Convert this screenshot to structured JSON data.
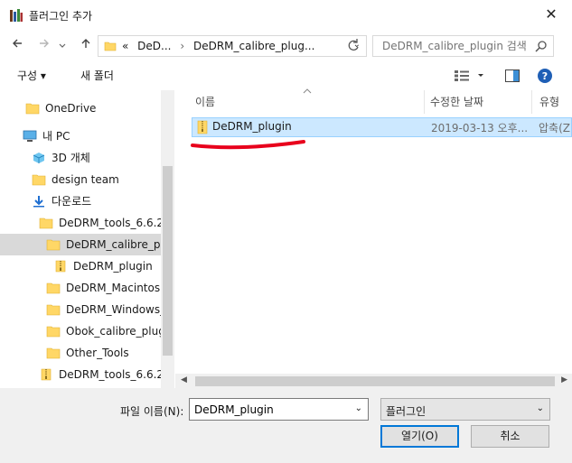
{
  "window": {
    "title": "플러그인 추가",
    "close_glyph": "✕"
  },
  "navigation": {
    "breadcrumb": {
      "prefix": "«",
      "items": [
        "DeD...",
        "DeDRM_calibre_plug..."
      ]
    },
    "search_placeholder": "DeDRM_calibre_plugin 검색"
  },
  "toolbar": {
    "organize_label": "구성 ▾",
    "new_folder_label": "새 폴더"
  },
  "sidebar": {
    "items": [
      {
        "label": "OneDrive",
        "icon": "folder-icon"
      },
      {
        "label": "내 PC",
        "icon": "pc-icon"
      },
      {
        "label": "3D 개체",
        "icon": "cube-icon"
      },
      {
        "label": "design team",
        "icon": "folder-icon"
      },
      {
        "label": "다운로드",
        "icon": "download-icon"
      },
      {
        "label": "DeDRM_tools_6.6.2",
        "icon": "folder-icon"
      },
      {
        "label": "DeDRM_calibre_plug",
        "icon": "folder-icon",
        "selected": true
      },
      {
        "label": "DeDRM_plugin",
        "icon": "zip-folder-icon"
      },
      {
        "label": "DeDRM_Macintosh_",
        "icon": "folder-icon"
      },
      {
        "label": "DeDRM_Windows_A",
        "icon": "folder-icon"
      },
      {
        "label": "Obok_calibre_plugin",
        "icon": "folder-icon"
      },
      {
        "label": "Other_Tools",
        "icon": "folder-icon"
      },
      {
        "label": "DeDRM_tools_6.6.2",
        "icon": "zip-folder-icon"
      }
    ]
  },
  "file_list": {
    "columns": [
      "이름",
      "수정한 날짜",
      "유형"
    ],
    "rows": [
      {
        "name": "DeDRM_plugin",
        "date": "2019-03-13 오후...",
        "type": "압축(Z"
      }
    ],
    "annotation_color": "#e8001c"
  },
  "footer": {
    "filename_label": "파일 이름(N):",
    "filename_value": "DeDRM_plugin",
    "filter_value": "플러그인",
    "open_label": "열기(O)",
    "cancel_label": "취소"
  },
  "colors": {
    "accent": "#0078d7",
    "selection": "#cce8ff",
    "folder": "#ffd766"
  }
}
